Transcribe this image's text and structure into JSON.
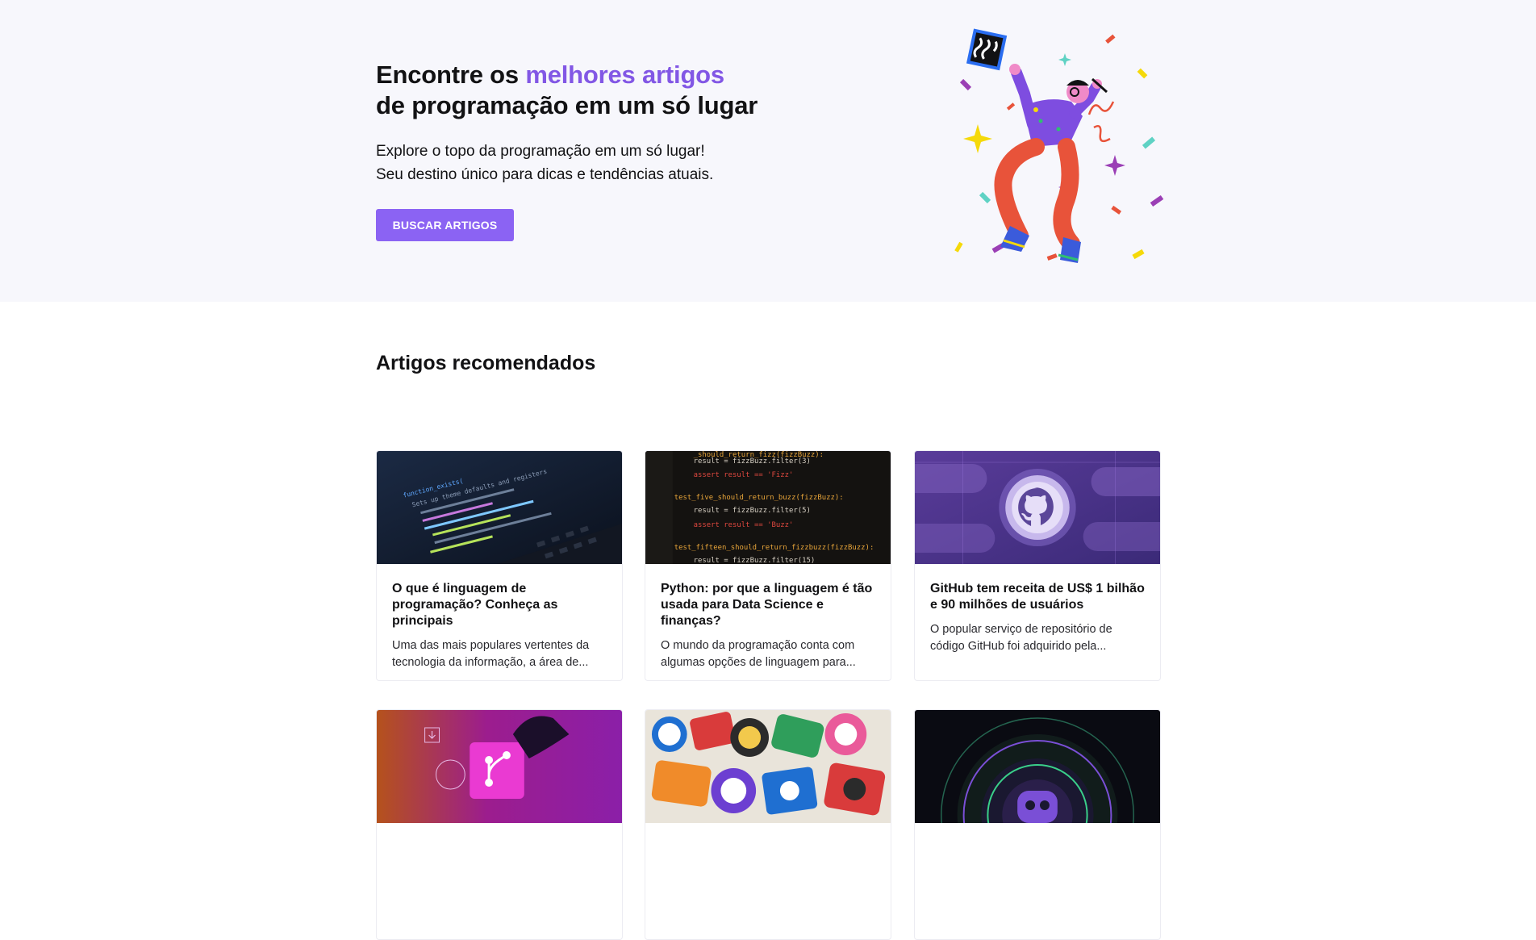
{
  "hero": {
    "title_prefix": "Encontre os ",
    "title_accent": "melhores artigos",
    "title_suffix": "de programação em um só lugar",
    "subtitle_line1": "Explore o topo da programação em um só lugar!",
    "subtitle_line2": "Seu destino único para dicas e tendências atuais.",
    "button_label": "BUSCAR ARTIGOS",
    "accent_color": "#8257e5",
    "button_color": "#8b63f3"
  },
  "recommended": {
    "heading": "Artigos recomendados",
    "articles": [
      {
        "title": "O que é linguagem de programação? Conheça as principais",
        "excerpt": "Uma das mais populares vertentes da tecnologia da informação, a área de...",
        "image": "laptop-code-thumbnail"
      },
      {
        "title": "Python: por que a linguagem é tão usada para Data Science e finanças?",
        "excerpt": "O mundo da programação conta com algumas opções de linguagem para...",
        "image": "python-code-thumbnail"
      },
      {
        "title": "GitHub tem receita de US$ 1 bilhão e 90 milhões de usuários",
        "excerpt": "O popular serviço de repositório de código GitHub foi adquirido pela...",
        "image": "github-logo-thumbnail"
      },
      {
        "title": "",
        "excerpt": "",
        "image": "git-branch-thumbnail"
      },
      {
        "title": "",
        "excerpt": "",
        "image": "octocat-stickers-thumbnail"
      },
      {
        "title": "",
        "excerpt": "",
        "image": "copilot-thumbnail"
      }
    ]
  },
  "code_lines": {
    "line1": "result = fizzBuzz.filter(3)",
    "line2": "assert result == 'Fizz'",
    "line3": "test_five_should_return_buzz(fizzBuzz):",
    "line4": "result = fizzBuzz.filter(5)",
    "line5": "assert result == 'Buzz'",
    "line6": "test_fifteen_should_return_fizzbuzz(fizzBuzz):",
    "line7": "result = fizzBuzz.filter(15)",
    "line0": "_should_return_fizz(fizzBuzz):",
    "laptop1": "function_exists(",
    "laptop2": "Sets up theme defaults and registers"
  }
}
